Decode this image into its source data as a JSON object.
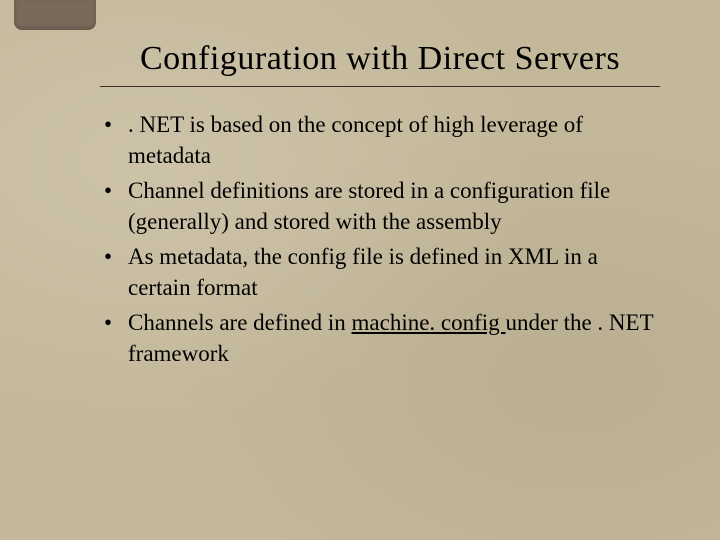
{
  "title": "Configuration with Direct Servers",
  "bullets": [
    ". NET is based on the concept of high leverage of metadata",
    "Channel definitions are stored in a configuration file (generally) and stored with the assembly",
    "As metadata, the config file is defined in XML in a certain format"
  ],
  "bullet4_prefix": "Channels are defined in ",
  "bullet4_underlined": "machine. config ",
  "bullet4_suffix": "under the . NET framework"
}
